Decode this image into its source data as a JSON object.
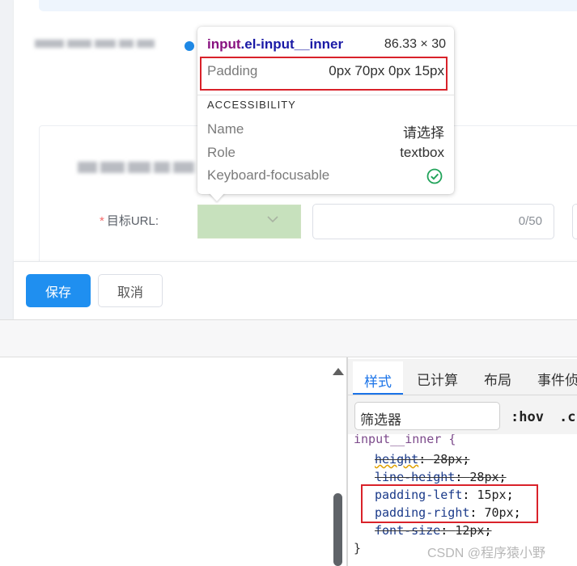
{
  "form": {
    "url_label_star": "*",
    "url_label": "目标URL:",
    "select_value": "",
    "url_counter": "0/50",
    "save_label": "保存",
    "cancel_label": "取消"
  },
  "tooltip": {
    "tag": "input",
    "class_name": ".el-input__inner",
    "size": "86.33 × 30",
    "padding_label": "Padding",
    "padding_value": "0px 70px 0px 15px",
    "accessibility_title": "ACCESSIBILITY",
    "name_label": "Name",
    "name_value": "请选择",
    "role_label": "Role",
    "role_value": "textbox",
    "keyboard_label": "Keyboard-focusable",
    "keyboard_icon": "check-circle-icon"
  },
  "devtools": {
    "tabs": [
      "样式",
      "已计算",
      "布局",
      "事件侦"
    ],
    "filter_placeholder": "筛选器",
    "hov_label": ":hov",
    "cls_label": ".c",
    "selector": "input__inner {",
    "declarations": [
      {
        "prop": "height",
        "value": "28px",
        "struck": true
      },
      {
        "prop": "line-height",
        "value": "28px",
        "struck": true
      },
      {
        "prop": "padding-left",
        "value": "15px",
        "struck": false
      },
      {
        "prop": "padding-right",
        "value": "70px",
        "struck": false
      },
      {
        "prop": "font-size",
        "value": "12px",
        "struck": true
      }
    ],
    "close_brace": "}"
  },
  "watermark": "CSDN @程序猿小野",
  "colors": {
    "primary": "#1f8ff0",
    "highlight_box": "#d9222a",
    "required_star": "#f56c6c",
    "success_check": "#21a35a",
    "element_highlight": "#c7e1bd"
  }
}
